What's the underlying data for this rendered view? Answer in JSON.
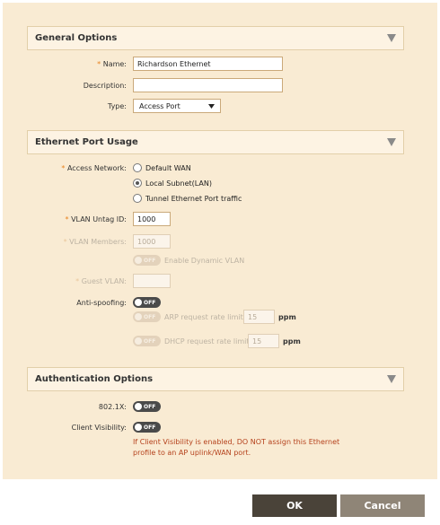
{
  "sections": {
    "general": "General Options",
    "ethernet": "Ethernet Port Usage",
    "auth": "Authentication Options"
  },
  "general": {
    "name_label": "Name:",
    "name_value": "Richardson Ethernet",
    "description_label": "Description:",
    "description_value": "",
    "type_label": "Type:",
    "type_value": "Access Port"
  },
  "ethernet": {
    "access_network_label": "Access Network:",
    "options": [
      "Default WAN",
      "Local Subnet(LAN)",
      "Tunnel Ethernet Port traffic"
    ],
    "selected_index": 1,
    "vlan_untag_label": "VLAN Untag ID:",
    "vlan_untag_value": "1000",
    "vlan_members_label": "VLAN Members:",
    "vlan_members_value": "1000",
    "dynamic_vlan_label": "Enable Dynamic VLAN",
    "guest_vlan_label": "Guest VLAN:",
    "guest_vlan_value": "",
    "antispoof_label": "Anti-spoofing:",
    "arp_label": "ARP request rate limit",
    "arp_value": "15",
    "arp_unit": "ppm",
    "dhcp_label": "DHCP request rate limit",
    "dhcp_value": "15",
    "dhcp_unit": "ppm"
  },
  "auth": {
    "dot1x_label": "802.1X:",
    "client_vis_label": "Client Visibility:",
    "warning": "If Client Visibility is enabled, DO NOT assign this Ethernet profile to an AP uplink/WAN port."
  },
  "toggle_off_text": "OFF",
  "required_mark": "*",
  "buttons": {
    "ok": "OK",
    "cancel": "Cancel"
  },
  "colors": {
    "accent": "#e8821e",
    "warning": "#b5421d",
    "panel": "#f9ebd3"
  }
}
